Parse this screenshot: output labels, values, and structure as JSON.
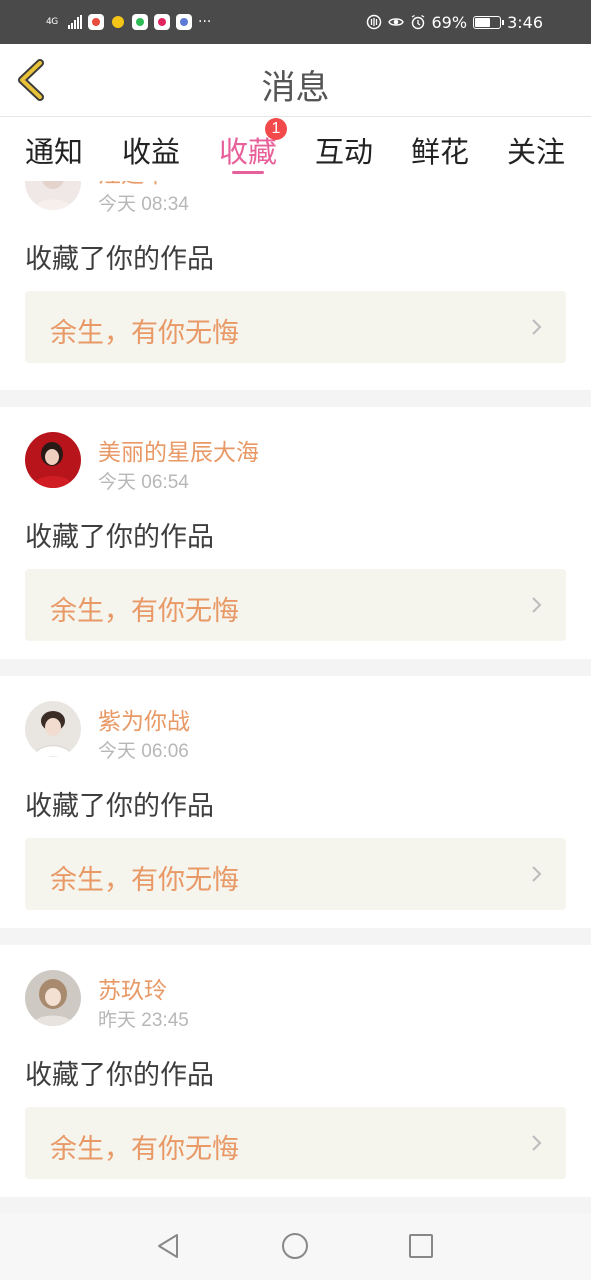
{
  "status_bar": {
    "network": "4G",
    "battery_level": 0.69,
    "battery_text": "69%",
    "time": "3:46",
    "dots": "···"
  },
  "header": {
    "title": "消息",
    "back_icon": "chevron-left-icon",
    "back_color": "#e8c23a"
  },
  "tabs": [
    {
      "label": "通知"
    },
    {
      "label": "收益"
    },
    {
      "label": "收藏",
      "active": true,
      "badge": "1"
    },
    {
      "label": "互动"
    },
    {
      "label": "鲜花"
    },
    {
      "label": "关注"
    }
  ],
  "colors": {
    "accent": "#e8609a",
    "name": "#e89966",
    "badge": "#f24a4a",
    "work_bg": "#f5f4ed"
  },
  "messages": [
    {
      "name": "汪建华",
      "time": "今天 08:34",
      "action": "收藏了你的作品",
      "work": "余生，有你无悔"
    },
    {
      "name": "美丽的星辰大海",
      "time": "今天 06:54",
      "action": "收藏了你的作品",
      "work": "余生，有你无悔"
    },
    {
      "name": "紫为你战",
      "time": "今天 06:06",
      "action": "收藏了你的作品",
      "work": "余生，有你无悔"
    },
    {
      "name": "苏玖玲",
      "time": "昨天 23:45",
      "action": "收藏了你的作品",
      "work": "余生，有你无悔"
    }
  ],
  "nav": {
    "back": "triangle-back-icon",
    "home": "circle-home-icon",
    "recents": "square-recents-icon"
  }
}
